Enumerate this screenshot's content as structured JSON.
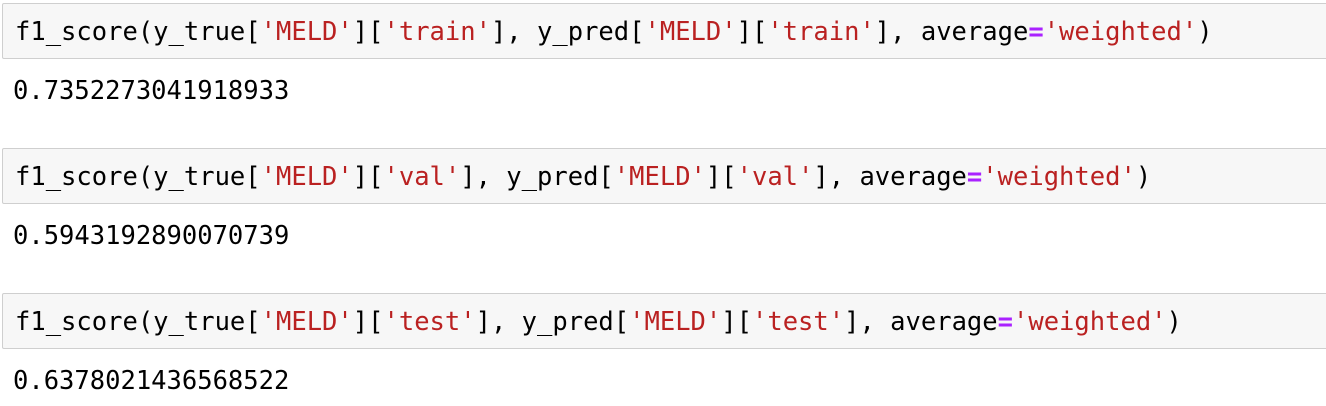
{
  "cells": [
    {
      "tokens": [
        {
          "t": "f1_score(y_true[",
          "k": "plain"
        },
        {
          "t": "'MELD'",
          "k": "str"
        },
        {
          "t": "][",
          "k": "plain"
        },
        {
          "t": "'train'",
          "k": "str"
        },
        {
          "t": "], y_pred[",
          "k": "plain"
        },
        {
          "t": "'MELD'",
          "k": "str"
        },
        {
          "t": "][",
          "k": "plain"
        },
        {
          "t": "'train'",
          "k": "str"
        },
        {
          "t": "], average",
          "k": "plain"
        },
        {
          "t": "=",
          "k": "op"
        },
        {
          "t": "'weighted'",
          "k": "str"
        },
        {
          "t": ")",
          "k": "plain"
        }
      ],
      "output": "0.7352273041918933"
    },
    {
      "tokens": [
        {
          "t": "f1_score(y_true[",
          "k": "plain"
        },
        {
          "t": "'MELD'",
          "k": "str"
        },
        {
          "t": "][",
          "k": "plain"
        },
        {
          "t": "'val'",
          "k": "str"
        },
        {
          "t": "], y_pred[",
          "k": "plain"
        },
        {
          "t": "'MELD'",
          "k": "str"
        },
        {
          "t": "][",
          "k": "plain"
        },
        {
          "t": "'val'",
          "k": "str"
        },
        {
          "t": "], average",
          "k": "plain"
        },
        {
          "t": "=",
          "k": "op"
        },
        {
          "t": "'weighted'",
          "k": "str"
        },
        {
          "t": ")",
          "k": "plain"
        }
      ],
      "output": "0.5943192890070739"
    },
    {
      "tokens": [
        {
          "t": "f1_score(y_true[",
          "k": "plain"
        },
        {
          "t": "'MELD'",
          "k": "str"
        },
        {
          "t": "][",
          "k": "plain"
        },
        {
          "t": "'test'",
          "k": "str"
        },
        {
          "t": "], y_pred[",
          "k": "plain"
        },
        {
          "t": "'MELD'",
          "k": "str"
        },
        {
          "t": "][",
          "k": "plain"
        },
        {
          "t": "'test'",
          "k": "str"
        },
        {
          "t": "], average",
          "k": "plain"
        },
        {
          "t": "=",
          "k": "op"
        },
        {
          "t": "'weighted'",
          "k": "str"
        },
        {
          "t": ")",
          "k": "plain"
        }
      ],
      "output": "0.6378021436568522"
    }
  ]
}
